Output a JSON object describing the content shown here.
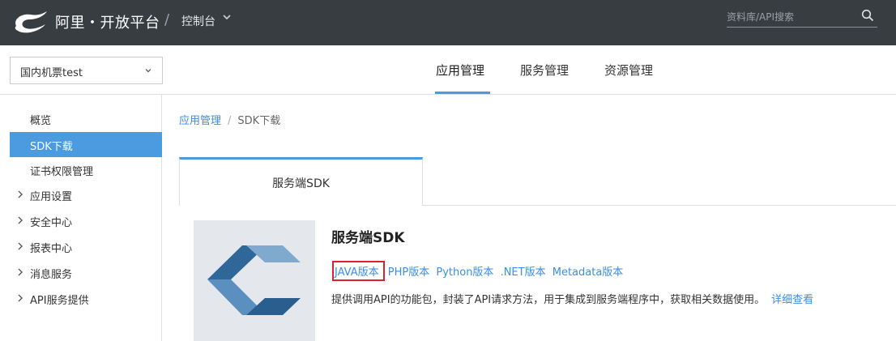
{
  "header": {
    "brand": "阿里・开放平台",
    "separator": "/",
    "console": "控制台",
    "search_placeholder": "资料库/API搜索"
  },
  "subbar": {
    "app_selected": "国内机票test",
    "tabs": [
      {
        "label": "应用管理",
        "active": true
      },
      {
        "label": "服务管理",
        "active": false
      },
      {
        "label": "资源管理",
        "active": false
      }
    ]
  },
  "sidebar": {
    "items": [
      {
        "label": "概览",
        "active": false,
        "expandable": false
      },
      {
        "label": "SDK下载",
        "active": true,
        "expandable": false
      },
      {
        "label": "证书权限管理",
        "active": false,
        "expandable": false
      },
      {
        "label": "应用设置",
        "active": false,
        "expandable": true
      },
      {
        "label": "安全中心",
        "active": false,
        "expandable": true
      },
      {
        "label": "报表中心",
        "active": false,
        "expandable": true
      },
      {
        "label": "消息服务",
        "active": false,
        "expandable": true
      },
      {
        "label": "API服务提供",
        "active": false,
        "expandable": true
      }
    ]
  },
  "breadcrumb": {
    "parent": "应用管理",
    "separator": "/",
    "current": "SDK下载"
  },
  "content": {
    "tab_label": "服务端SDK",
    "title": "服务端SDK",
    "links": [
      "JAVA版本",
      "PHP版本",
      "Python版本",
      ".NET版本",
      "Metadata版本"
    ],
    "description": "提供调用API的功能包，封装了API请求方法，用于集成到服务端程序中，获取相关数据使用。",
    "detail_link": "详细查看"
  },
  "colors": {
    "topbar": "#373d41",
    "accent": "#4a9be0",
    "link": "#3a8ee6",
    "highlight_box": "#d9232e"
  }
}
